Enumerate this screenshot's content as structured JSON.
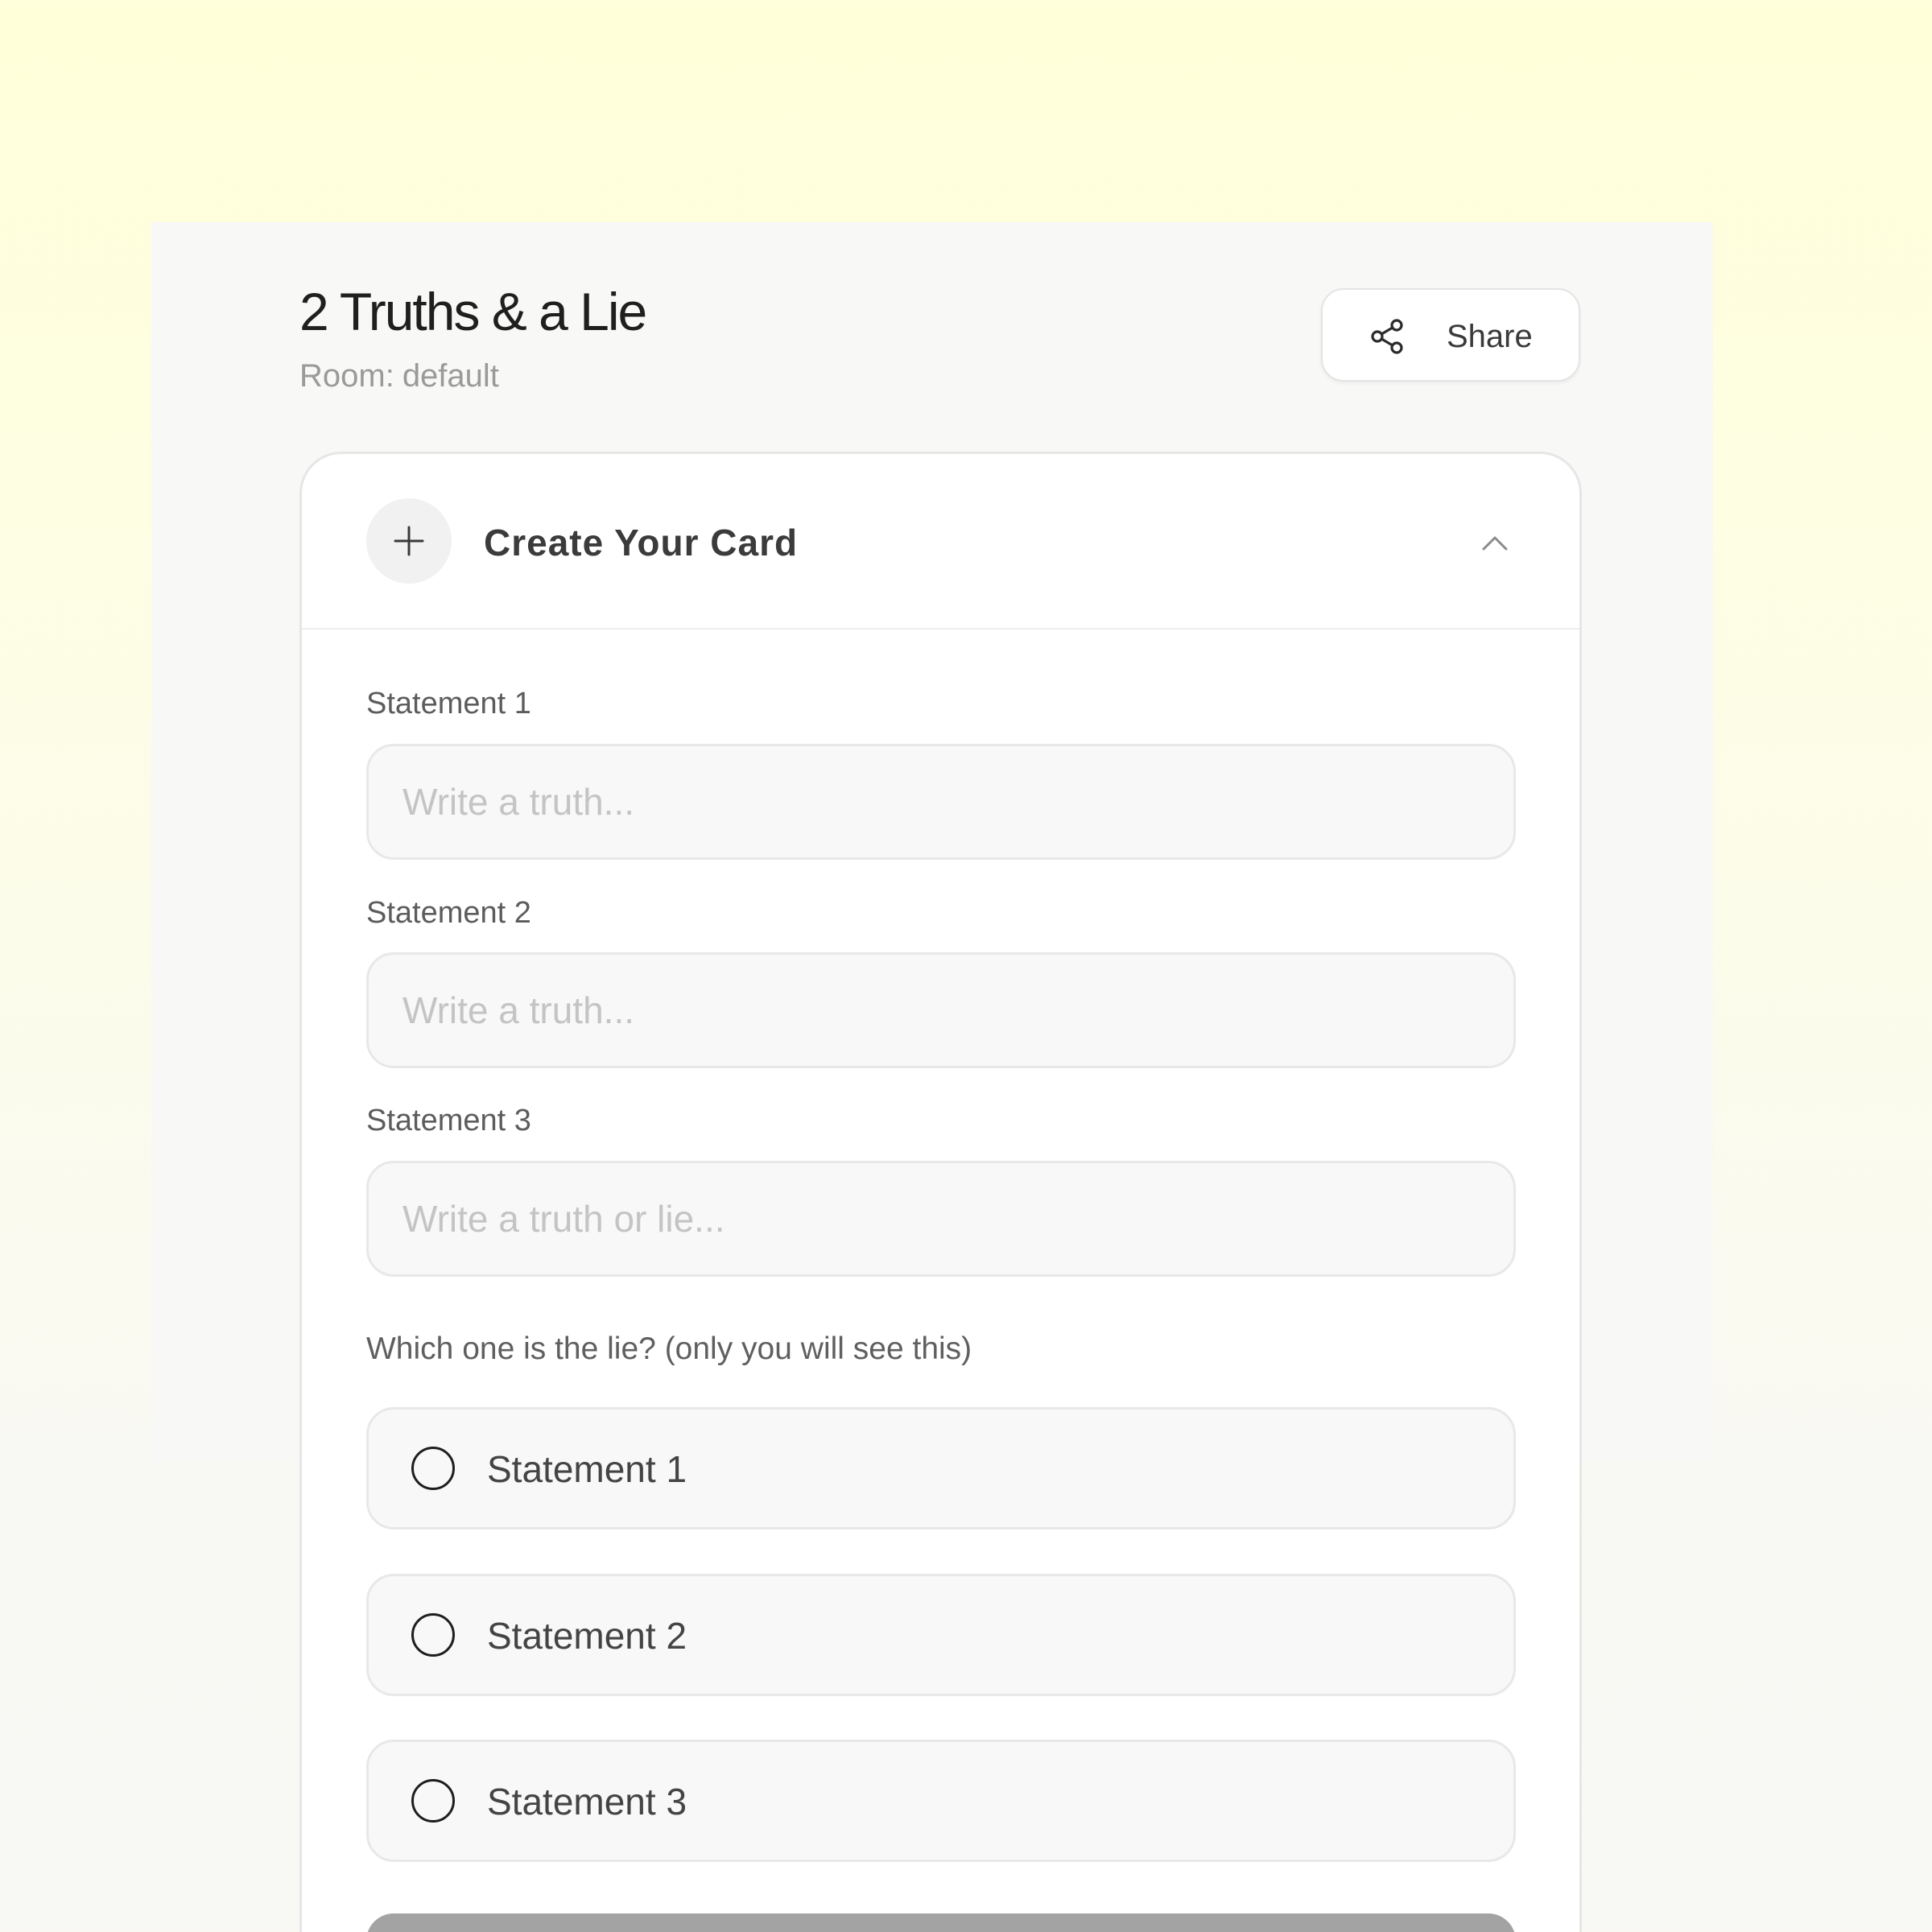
{
  "header": {
    "title": "2 Truths & a Lie",
    "room_label": "Room:",
    "room_name": "default",
    "share_label": "Share"
  },
  "card": {
    "title": "Create Your Card",
    "statements": [
      {
        "label": "Statement 1",
        "placeholder": "Write a truth...",
        "value": ""
      },
      {
        "label": "Statement 2",
        "placeholder": "Write a truth...",
        "value": ""
      },
      {
        "label": "Statement 3",
        "placeholder": "Write a truth or lie...",
        "value": ""
      }
    ],
    "lie_question": "Which one is the lie? (only you will see this)",
    "lie_options": [
      "Statement 1",
      "Statement 2",
      "Statement 3"
    ],
    "selected_lie": null
  },
  "icons": {
    "share": "share-icon",
    "add": "plus-icon",
    "collapse": "chevron-up-icon",
    "radio": "radio-unchecked-icon"
  },
  "colors": {
    "background_top": "#ffffd9",
    "background_bottom": "#f8f8f5",
    "panel": "#f8f8f6",
    "card": "#ffffff",
    "submit_button_disabled": "#a3a3a3"
  }
}
